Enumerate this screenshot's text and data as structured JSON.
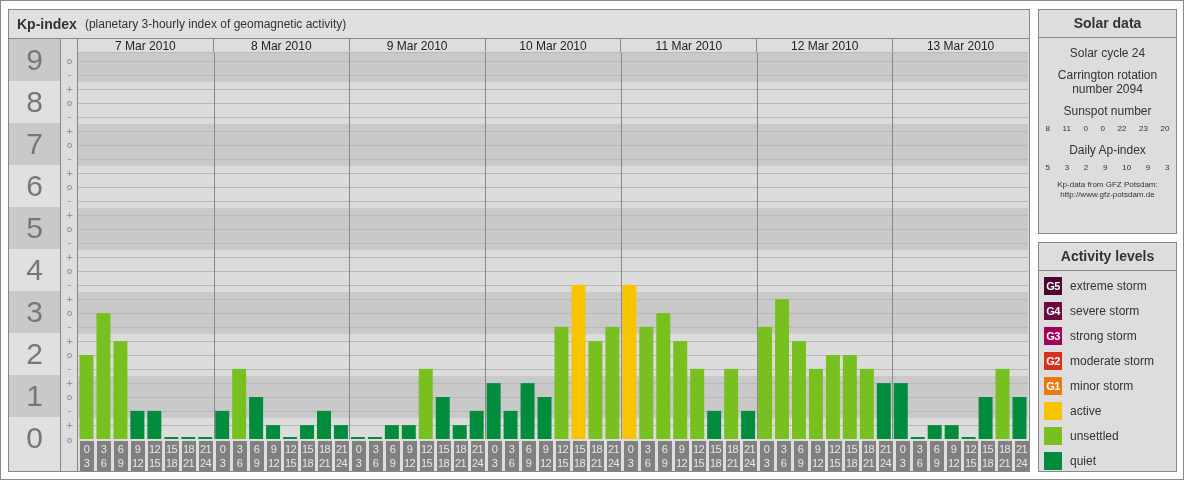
{
  "title": {
    "name": "Kp-index",
    "subtitle": "(planetary 3-hourly index of geomagnetic activity)"
  },
  "chart": {
    "days": [
      "7 Mar 2010",
      "8 Mar 2010",
      "9 Mar 2010",
      "10 Mar 2010",
      "11 Mar 2010",
      "12 Mar 2010",
      "13 Mar 2010"
    ],
    "scale_marks": [
      "o",
      "–",
      "+",
      "o",
      "–",
      "+",
      "o",
      "–",
      "+",
      "o",
      "–",
      "+",
      "o",
      "–",
      "+",
      "o",
      "–",
      "+",
      "o",
      "–",
      "+",
      "o",
      "–",
      "+",
      "o",
      "–",
      "+",
      "o"
    ],
    "chart_data": {
      "type": "bar",
      "stacked": true,
      "grid": true,
      "ylim": [
        0,
        9.19
      ],
      "yticks": [
        0,
        1,
        2,
        3,
        4,
        5,
        6,
        7,
        8,
        9
      ],
      "categories": [
        "0 3",
        "3 6",
        "6 9",
        "9 12",
        "12 15",
        "15 18",
        "18 21",
        "21 24",
        "0 3",
        "3 6",
        "6 9",
        "9 12",
        "12 15",
        "15 18",
        "18 21",
        "21 24",
        "0 3",
        "3 6",
        "6 9",
        "9 12",
        "12 15",
        "15 18",
        "18 21",
        "21 24",
        "0 3",
        "3 6",
        "6 9",
        "9 12",
        "12 15",
        "15 18",
        "18 21",
        "21 24",
        "0 3",
        "3 6",
        "6 9",
        "9 12",
        "12 15",
        "15 18",
        "18 21",
        "21 24",
        "0 3",
        "3 6",
        "6 9",
        "9 12",
        "12 15",
        "15 18",
        "18 21",
        "21 24",
        "0 3",
        "3 6",
        "6 9",
        "9 12",
        "12 15",
        "15 18",
        "18 21",
        "21 24"
      ],
      "series": [
        {
          "name": "active",
          "color": "#f8c400",
          "values": [
            null,
            null,
            null,
            null,
            null,
            null,
            null,
            null,
            null,
            null,
            null,
            null,
            null,
            null,
            null,
            null,
            null,
            null,
            null,
            null,
            null,
            null,
            null,
            null,
            null,
            null,
            null,
            null,
            null,
            3.67,
            null,
            null,
            3.67,
            null,
            null,
            null,
            null,
            null,
            null,
            null,
            null,
            null,
            null,
            null,
            null,
            null,
            null,
            null,
            null,
            null,
            null,
            null,
            null,
            null,
            null,
            null
          ]
        },
        {
          "name": "unsettled",
          "color": "#78c020",
          "values": [
            2,
            3,
            2.33,
            null,
            null,
            null,
            null,
            null,
            null,
            1.67,
            null,
            null,
            null,
            null,
            null,
            null,
            null,
            null,
            null,
            null,
            1.67,
            null,
            null,
            null,
            null,
            null,
            null,
            null,
            2.67,
            null,
            2.33,
            2.67,
            null,
            2.67,
            3,
            2.33,
            1.67,
            null,
            1.67,
            null,
            2.67,
            3.33,
            2.33,
            1.67,
            2,
            2,
            1.67,
            null,
            null,
            null,
            null,
            null,
            null,
            null,
            1.67,
            null
          ]
        },
        {
          "name": "quiet",
          "color": "#008c3c",
          "values": [
            null,
            null,
            null,
            0.67,
            0.67,
            0,
            0,
            0,
            0.67,
            null,
            1,
            0.33,
            0,
            0.33,
            0.67,
            0.33,
            0,
            0,
            0.33,
            0.33,
            null,
            1,
            0.33,
            0.67,
            1.33,
            0.67,
            1.33,
            1,
            null,
            null,
            null,
            null,
            null,
            null,
            null,
            null,
            null,
            0.67,
            null,
            0.67,
            null,
            null,
            null,
            null,
            null,
            null,
            null,
            1.33,
            1.33,
            0,
            0.33,
            0.33,
            0,
            1,
            null,
            1
          ]
        }
      ]
    }
  },
  "solar_data": {
    "title": "Solar data",
    "cycle": "Solar cycle 24",
    "rotation": "Carrington rotation number 2094",
    "sunspot_label": "Sunspot number",
    "sunspot_numbers": [
      "8",
      "11",
      "0",
      "0",
      "22",
      "23",
      "20"
    ],
    "ap_label": "Daily Ap-index",
    "ap_values": [
      "5",
      "3",
      "2",
      "9",
      "10",
      "9",
      "3"
    ],
    "source": "Kp-data from GFZ Potsdam:",
    "source_url": "http://www.gfz-potsdam.de"
  },
  "activity_levels": {
    "title": "Activity levels",
    "storm_levels": [
      {
        "badge": "G5",
        "label": "extreme storm",
        "color": "#500030"
      },
      {
        "badge": "G4",
        "label": "severe storm",
        "color": "#6a0a40"
      },
      {
        "badge": "G3",
        "label": "strong storm",
        "color": "#a0005a"
      },
      {
        "badge": "G2",
        "label": "moderate storm",
        "color": "#d83020"
      },
      {
        "badge": "G1",
        "label": "minor storm",
        "color": "#e87a10"
      }
    ]
  }
}
